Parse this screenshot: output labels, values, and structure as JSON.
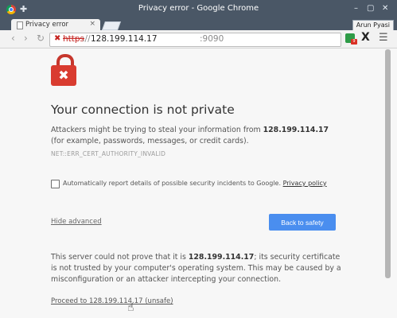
{
  "window": {
    "title": "Privacy error - Google Chrome"
  },
  "tab": {
    "title": "Privacy error",
    "close": "×"
  },
  "user": {
    "name": "Arun Pyasi"
  },
  "toolbar": {
    "back": "‹",
    "forward": "›",
    "reload": "↻",
    "url_scheme": "https",
    "url_separator": "://",
    "url_host": "128.199.114.17",
    "url_port": ":9090",
    "ext_badge": "9",
    "menu": "☰"
  },
  "window_buttons": {
    "min": "–",
    "max": "▢",
    "close": "✕"
  },
  "content": {
    "heading": "Your connection is not private",
    "intro_prefix": "Attackers might be trying to steal your information from ",
    "host": "128.199.114.17",
    "intro_suffix": " (for example, passwords, messages, or credit cards).",
    "error_code": "NET::ERR_CERT_AUTHORITY_INVALID",
    "report_text": "Automatically report details of possible security incidents to Google. ",
    "privacy_link": "Privacy policy",
    "hide_advanced": "Hide advanced",
    "back_button": "Back to safety",
    "detail_prefix": "This server could not prove that it is ",
    "detail_host": "128.199.114.17",
    "detail_suffix": "; its security certificate is not trusted by your computer's operating system. This may be caused by a misconfiguration or an attacker intercepting your connection.",
    "proceed_link": "Proceed to 128.199.114.17 (unsafe)"
  },
  "colors": {
    "accent": "#4a8eef",
    "danger": "#d93c30",
    "titlebar": "#4a5766"
  }
}
